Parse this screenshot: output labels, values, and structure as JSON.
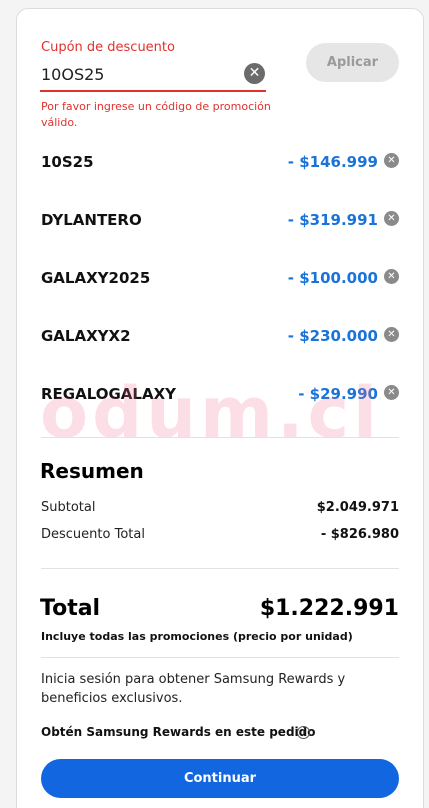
{
  "coupon": {
    "label": "Cupón de descuento",
    "value": "10OS25",
    "clear_symbol": "✕",
    "error": "Por favor ingrese un código de promoción válido.",
    "apply_label": "Aplicar"
  },
  "applied_coupons": [
    {
      "code": "10S25",
      "amount": "- $146.999",
      "remove_symbol": "✕"
    },
    {
      "code": "DYLANTERO",
      "amount": "- $319.991",
      "remove_symbol": "✕"
    },
    {
      "code": "GALAXY2025",
      "amount": "- $100.000",
      "remove_symbol": "✕"
    },
    {
      "code": "GALAXYX2",
      "amount": "- $230.000",
      "remove_symbol": "✕"
    },
    {
      "code": "REGALOGALAXY",
      "amount": "- $29.990",
      "remove_symbol": "✕"
    }
  ],
  "summary": {
    "title": "Resumen",
    "subtotal_label": "Subtotal",
    "subtotal_value": "$2.049.971",
    "discount_label": "Descuento Total",
    "discount_value": "- $826.980"
  },
  "total": {
    "label": "Total",
    "value": "$1.222.991",
    "note": "Incluye todas las promociones (precio por unidad)"
  },
  "rewards": {
    "text": "Inicia sesión para obtener Samsung Rewards y beneficios exclusivos.",
    "link": "Obtén Samsung Rewards en este pedido",
    "info_symbol": "i"
  },
  "continue_label": "Continuar",
  "watermark": "odum.cl",
  "colors": {
    "error": "#e0322d",
    "discount": "#1a73d9",
    "primary_button": "#1267e0"
  }
}
